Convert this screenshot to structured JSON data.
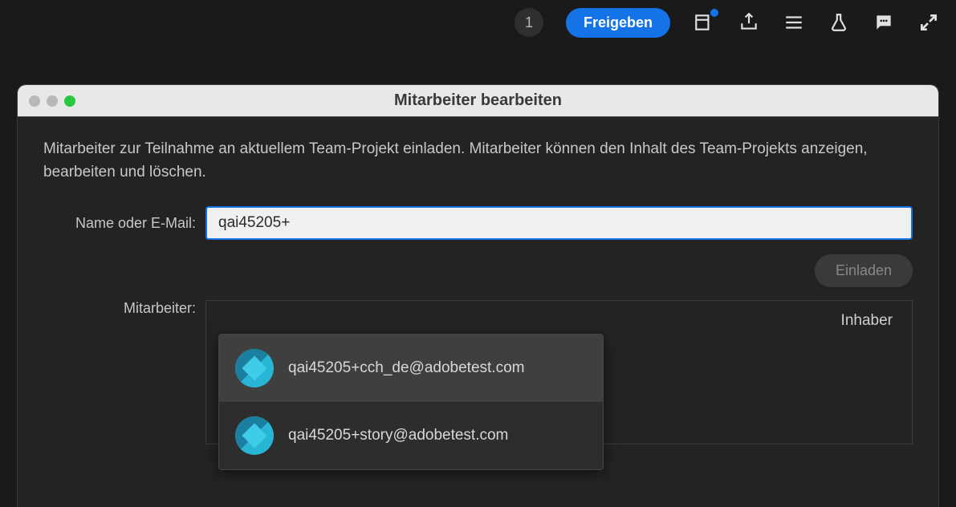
{
  "toolbar": {
    "badge_count": "1",
    "share_label": "Freigeben"
  },
  "modal": {
    "title": "Mitarbeiter bearbeiten",
    "description": "Mitarbeiter zur Teilnahme an aktuellem Team-Projekt einladen. Mitarbeiter können den Inhalt des Team-Projekts anzeigen, bearbeiten und löschen.",
    "name_or_email_label": "Name oder E-Mail:",
    "email_input_value": "qai45205+",
    "invite_label": "Einladen",
    "collaborators_label": "Mitarbeiter:",
    "owner_role": "Inhaber"
  },
  "autocomplete": {
    "items": [
      {
        "email": "qai45205+cch_de@adobetest.com",
        "highlighted": true
      },
      {
        "email": "qai45205+story@adobetest.com",
        "highlighted": false
      }
    ]
  }
}
